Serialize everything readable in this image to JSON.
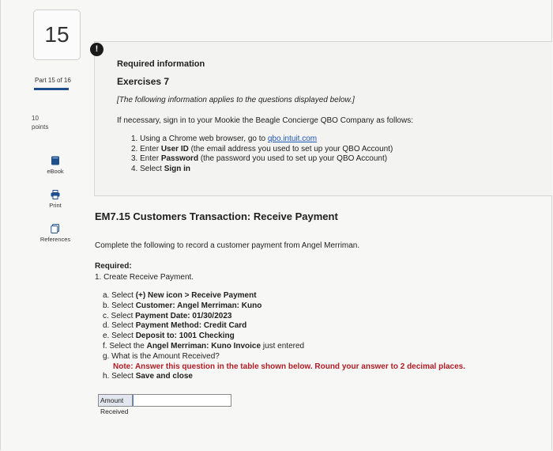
{
  "rail": {
    "question_number": "15",
    "part_label": "Part 15 of 16",
    "points_value": "10",
    "points_label": "points",
    "tools": [
      {
        "label": "eBook"
      },
      {
        "label": "Print"
      },
      {
        "label": "References"
      }
    ]
  },
  "alert_badge": "!",
  "info": {
    "title": "Required information",
    "subtitle": "Exercises 7",
    "note": "[The following information applies to the questions displayed below.]",
    "intro": "If necessary, sign in to your Mookie the Beagle Concierge QBO Company as follows:",
    "steps": [
      {
        "prefix": "1. Using a Chrome web browser, go to ",
        "link": "qbo.intuit.com",
        "suffix": ""
      },
      {
        "prefix": "2. Enter ",
        "bold": "User ID",
        "suffix": " (the email address you used to set up your QBO Account)"
      },
      {
        "prefix": "3. Enter ",
        "bold": "Password",
        "suffix": " (the password you used to set up your QBO Account)"
      },
      {
        "prefix": "4. Select ",
        "bold": "Sign in",
        "suffix": ""
      }
    ]
  },
  "exercise": {
    "heading": "EM7.15 Customers Transaction: Receive Payment",
    "instruction": "Complete the following to record a customer payment from Angel Merriman.",
    "required_label": "Required:",
    "required_item": "1. Create Receive Payment.",
    "sub_steps": [
      {
        "prefix": "a. Select ",
        "bold": "(+) New icon > Receive Payment",
        "suffix": ""
      },
      {
        "prefix": "b. Select ",
        "bold": "Customer: Angel Merriman: Kuno",
        "suffix": ""
      },
      {
        "prefix": "c. Select ",
        "bold": "Payment Date: 01/30/2023",
        "suffix": ""
      },
      {
        "prefix": "d. Select ",
        "bold": "Payment Method: Credit Card",
        "suffix": ""
      },
      {
        "prefix": "e. Select ",
        "bold": "Deposit to: 1001 Checking",
        "suffix": ""
      },
      {
        "prefix": "f. Select the ",
        "bold": "Angel Merriman: Kuno Invoice",
        "suffix": " just entered"
      },
      {
        "prefix": "g. What is the Amount Received?",
        "bold": "",
        "suffix": ""
      },
      {
        "note": "Note: Answer this question in the table shown below. Round your answer to 2 decimal places."
      },
      {
        "prefix": "h. Select ",
        "bold": "Save and close",
        "suffix": ""
      }
    ],
    "answer_label": "Amount Received",
    "answer_value": ""
  },
  "colors": {
    "link": "#1f57b5",
    "note_red": "#b01c24",
    "progress_bar": "#1e4f8c",
    "ebook_icon": "#1e4f8c"
  }
}
